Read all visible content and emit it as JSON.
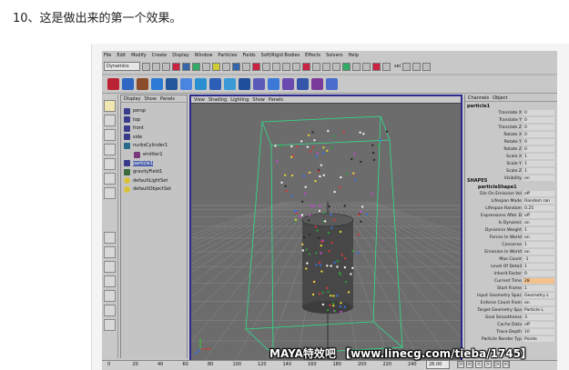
{
  "page": {
    "heading": "10、这是做出来的第一个效果。"
  },
  "menubar": [
    "File",
    "Edit",
    "Modify",
    "Create",
    "Display",
    "Window",
    "Particles",
    "Fields",
    "Soft/Rigid Bodies",
    "Effects",
    "Solvers",
    "Help"
  ],
  "statusline": {
    "mode": "Dynamics",
    "sel_label": "sel"
  },
  "outliner": {
    "menu": [
      "Display",
      "Show",
      "Panels"
    ],
    "items": [
      {
        "label": "persp",
        "icon": "camera-icon",
        "color": "#3b3b8c"
      },
      {
        "label": "top",
        "icon": "camera-icon",
        "color": "#3b3b8c"
      },
      {
        "label": "front",
        "icon": "camera-icon",
        "color": "#3b3b8c"
      },
      {
        "label": "side",
        "icon": "camera-icon",
        "color": "#3b3b8c"
      },
      {
        "label": "nurbsCylinder1",
        "icon": "nurbs-icon",
        "color": "#2a6a8a"
      },
      {
        "label": "emitter1",
        "icon": "emitter-icon",
        "color": "#7a3a7a"
      },
      {
        "label": "particle1",
        "icon": "particle-icon",
        "color": "#3b3b8c"
      },
      {
        "label": "gravityField1",
        "icon": "gravity-icon",
        "color": "#3a6a3a"
      },
      {
        "label": "defaultLightSet",
        "icon": "set-icon",
        "color": "#d9c23a"
      },
      {
        "label": "defaultObjectSet",
        "icon": "set-icon",
        "color": "#d9c23a"
      }
    ]
  },
  "viewport": {
    "menu": [
      "View",
      "Shading",
      "Lighting",
      "Show",
      "Panels"
    ]
  },
  "channelbox": {
    "menu": [
      "Channels",
      "Object"
    ],
    "node": "particle1",
    "transforms": [
      {
        "name": "Translate X",
        "value": "0"
      },
      {
        "name": "Translate Y",
        "value": "0"
      },
      {
        "name": "Translate Z",
        "value": "0"
      },
      {
        "name": "Rotate X",
        "value": "0"
      },
      {
        "name": "Rotate Y",
        "value": "0"
      },
      {
        "name": "Rotate Z",
        "value": "0"
      },
      {
        "name": "Scale X",
        "value": "1"
      },
      {
        "name": "Scale Y",
        "value": "1"
      },
      {
        "name": "Scale Z",
        "value": "1"
      },
      {
        "name": "Visibility",
        "value": "on"
      }
    ],
    "shapes_header": "SHAPES",
    "shape_node": "particleShape1",
    "shape_attrs": [
      {
        "name": "Die On Emission Vol",
        "value": "off"
      },
      {
        "name": "Lifespan Mode",
        "value": "Random ran"
      },
      {
        "name": "Lifespan Random",
        "value": "0.25"
      },
      {
        "name": "Expressions After D",
        "value": "off"
      },
      {
        "name": "Is Dynamic",
        "value": "on"
      },
      {
        "name": "Dynamics Weight",
        "value": "1"
      },
      {
        "name": "Forces In World",
        "value": "on"
      },
      {
        "name": "Conserve",
        "value": "1"
      },
      {
        "name": "Emission In World",
        "value": "on"
      },
      {
        "name": "Max Count",
        "value": "-1"
      },
      {
        "name": "Level Of Detail",
        "value": "1"
      },
      {
        "name": "Inherit Factor",
        "value": "0"
      },
      {
        "name": "Current Time",
        "value": "28"
      },
      {
        "name": "Start Frame",
        "value": "1"
      },
      {
        "name": "Input Geometry Spac",
        "value": "Geometry L"
      },
      {
        "name": "Enforce Count From",
        "value": "on"
      },
      {
        "name": "Target Geometry Spa",
        "value": "Particle L"
      },
      {
        "name": "Goal Smoothness",
        "value": "3"
      },
      {
        "name": "Cache Data",
        "value": "off"
      },
      {
        "name": "Trace Depth",
        "value": "10"
      },
      {
        "name": "Particle Render Typ",
        "value": "Points"
      }
    ]
  },
  "timeline": {
    "ticks": [
      "0",
      "20",
      "40",
      "60",
      "80",
      "100",
      "120",
      "140",
      "160",
      "180",
      "200",
      "220",
      "240"
    ],
    "current_frame": "28.00"
  },
  "watermark": "MAYA特效吧 【www.linecg.com/tieba/1745】"
}
